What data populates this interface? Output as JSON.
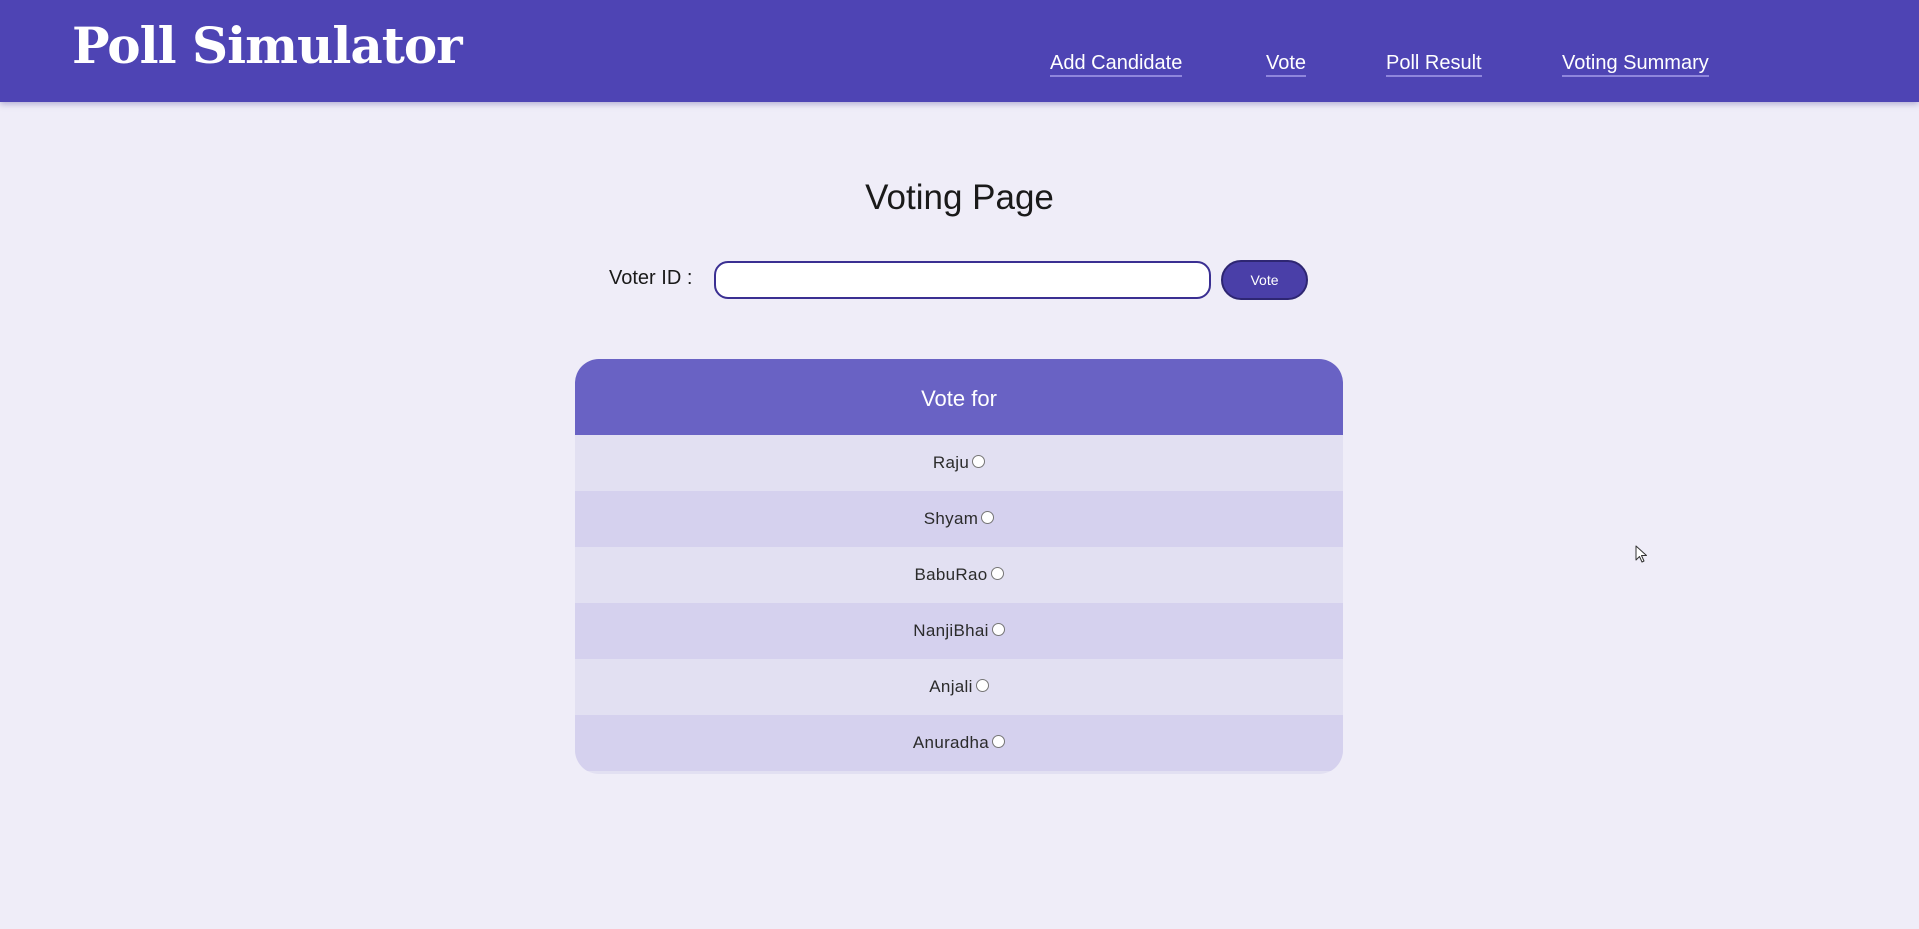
{
  "header": {
    "brand": "Poll Simulator",
    "nav": [
      {
        "label": "Add Candidate"
      },
      {
        "label": "Vote"
      },
      {
        "label": "Poll Result"
      },
      {
        "label": "Voting Summary"
      }
    ]
  },
  "main": {
    "title": "Voting Page",
    "voter_label": "Voter ID :",
    "voter_value": "",
    "vote_button": "Vote"
  },
  "card": {
    "header": "Vote for",
    "candidates": [
      {
        "name": "Raju",
        "selected": false
      },
      {
        "name": "Shyam",
        "selected": false
      },
      {
        "name": "BabuRao",
        "selected": false
      },
      {
        "name": "NanjiBhai",
        "selected": false
      },
      {
        "name": "Anjali",
        "selected": false
      },
      {
        "name": "Anuradha",
        "selected": false
      }
    ]
  },
  "colors": {
    "navbar": "#4e44b4",
    "background": "#efedf8",
    "card_header": "#6962c4",
    "row_light": "#e2e0f2",
    "row_dark": "#d5d1ee",
    "button": "#4a3fa8"
  },
  "icons": {
    "cursor": "mouse-pointer-icon",
    "radio": "radio-button-icon"
  }
}
